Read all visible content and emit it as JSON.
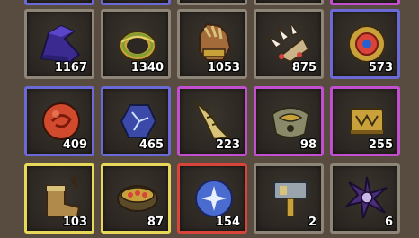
{
  "inventory": {
    "rows": [
      [
        {
          "id": "cap",
          "count": "1167",
          "rarity": "gray",
          "icon": "wizard-hat-icon"
        },
        {
          "id": "ring",
          "count": "1340",
          "rarity": "gray",
          "icon": "ring-icon"
        },
        {
          "id": "glove",
          "count": "1053",
          "rarity": "gray",
          "icon": "gauntlet-icon"
        },
        {
          "id": "claw",
          "count": "875",
          "rarity": "gray",
          "icon": "claw-icon"
        },
        {
          "id": "amulet",
          "count": "573",
          "rarity": "blue",
          "icon": "amulet-icon"
        }
      ],
      [
        {
          "id": "orb",
          "count": "409",
          "rarity": "blue",
          "icon": "red-orb-icon"
        },
        {
          "id": "crystal",
          "count": "465",
          "rarity": "blue",
          "icon": "crystal-stone-icon"
        },
        {
          "id": "horn",
          "count": "223",
          "rarity": "purple",
          "icon": "horn-icon"
        },
        {
          "id": "bracer",
          "count": "98",
          "rarity": "purple",
          "icon": "bracer-icon"
        },
        {
          "id": "band",
          "count": "255",
          "rarity": "purple",
          "icon": "bracelet-icon"
        }
      ],
      [
        {
          "id": "boot",
          "count": "103",
          "rarity": "yellow",
          "icon": "boot-icon"
        },
        {
          "id": "belt",
          "count": "87",
          "rarity": "yellow",
          "icon": "jeweled-belt-icon"
        },
        {
          "id": "gem",
          "count": "154",
          "rarity": "red",
          "icon": "star-gem-icon"
        },
        {
          "id": "hammer",
          "count": "2",
          "rarity": "gray",
          "icon": "hammer-icon"
        },
        {
          "id": "shuriken",
          "count": "6",
          "rarity": "gray",
          "icon": "shuriken-icon"
        }
      ]
    ],
    "partial_top_row_rarities": [
      "blue",
      "blue",
      "gray",
      "gray",
      "purple"
    ]
  },
  "colors": {
    "background": "#574c3f",
    "rarity_gray": "#8c8578",
    "rarity_blue": "#6a69d6",
    "rarity_purple": "#c24fd0",
    "rarity_yellow": "#e8d85a",
    "rarity_red": "#d8443a"
  }
}
